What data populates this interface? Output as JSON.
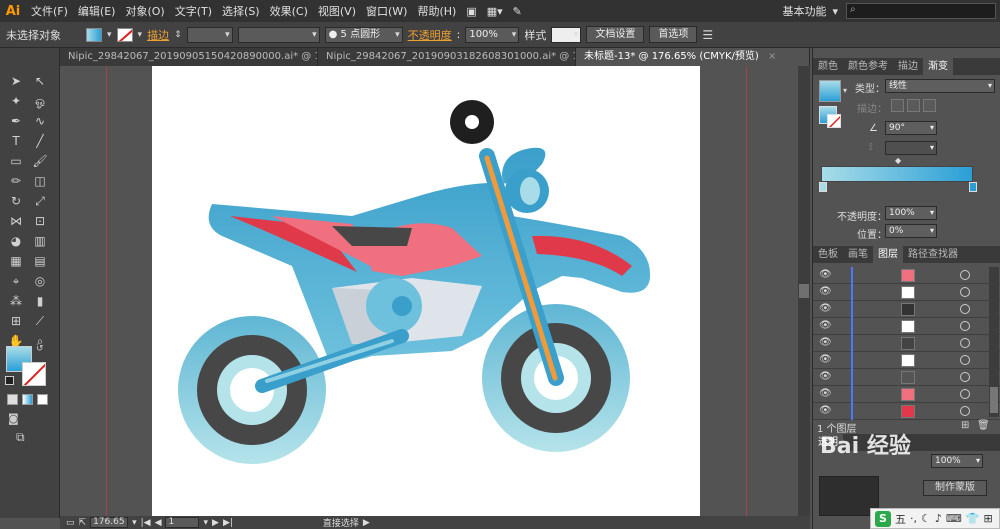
{
  "app": {
    "logo": "Ai",
    "accent": "#ff9a00"
  },
  "menu": {
    "items": [
      "文件(F)",
      "编辑(E)",
      "对象(O)",
      "文字(T)",
      "选择(S)",
      "效果(C)",
      "视图(V)",
      "窗口(W)",
      "帮助(H)"
    ],
    "workspace": "基本功能"
  },
  "control": {
    "no_selection": "未选择对象",
    "stroke_label": "描边",
    "brush": "5 点圆形",
    "opacity_label": "不透明度",
    "opacity_value": "100%",
    "style_label": "样式",
    "doc_setup": "文档设置",
    "preferences": "首选项"
  },
  "tabs": [
    {
      "label": "Nipic_29842067_20190905150420890000.ai* @ 14...",
      "active": false
    },
    {
      "label": "Nipic_29842067_20190903182608301000.ai* @ 12...",
      "active": false
    },
    {
      "label": "未标题-13* @ 176.65% (CMYK/预览)",
      "active": true
    }
  ],
  "status": {
    "zoom": "176.65",
    "page": "1",
    "tool": "直接选择"
  },
  "panel_top": {
    "tabs": [
      "颜色",
      "颜色参考",
      "描边",
      "渐变"
    ],
    "active_tab": "渐变",
    "type_label": "类型：",
    "type_value": "线性",
    "stroke_label": "描边：",
    "angle": "90°",
    "opacity_label": "不透明度：",
    "opacity_value": "100%",
    "position_label": "位置：",
    "position_value": "0%",
    "gradient_start": "#a8dce8",
    "gradient_end": "#2a9fd6"
  },
  "panel_layers": {
    "tabs": [
      "色板",
      "画笔",
      "图层",
      "路径查找器"
    ],
    "active_tab": "图层",
    "count": "1 个图层"
  },
  "panel_bottom": {
    "tab": "透明",
    "opacity_value": "100%",
    "mask_btn": "制作蒙版"
  },
  "watermark": {
    "text": "Bai 经验"
  },
  "taskbar": {
    "logo": "S",
    "ime": "五"
  },
  "colors": {
    "body_blue": "#3a9fca",
    "wheel_light": "#a9dde6",
    "seat_red": "#f07080",
    "fork_orange": "#f09a3a",
    "tire_dark": "#474747"
  }
}
